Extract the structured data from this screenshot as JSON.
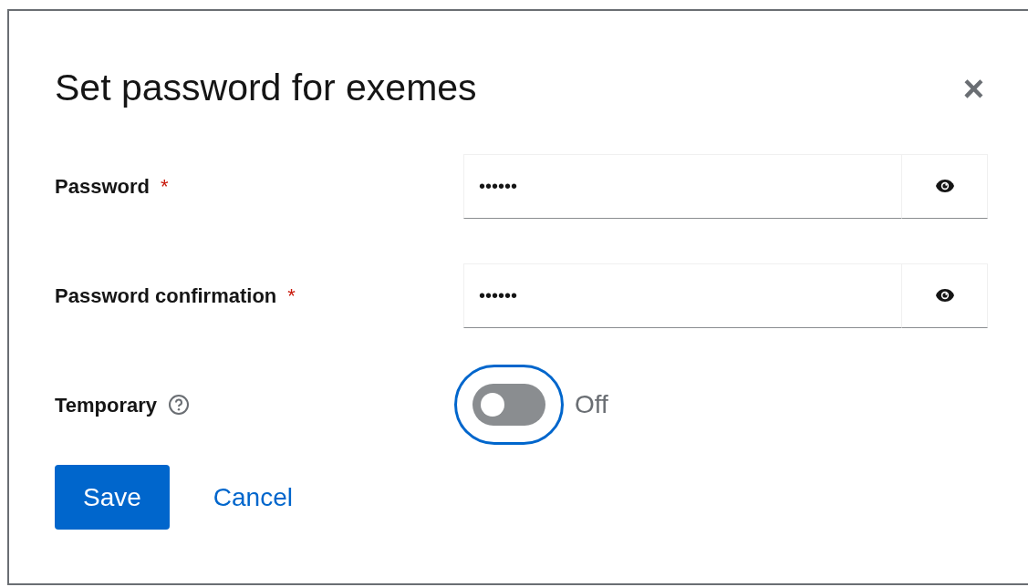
{
  "dialog": {
    "title": "Set password for exemes",
    "close": "×"
  },
  "fields": [
    {
      "kind": "password",
      "label": "Password",
      "required_mark": "*",
      "value": "••••••"
    },
    {
      "kind": "password",
      "label": "Password confirmation",
      "required_mark": "*",
      "value": "••••••"
    },
    {
      "kind": "switch",
      "label": "Temporary",
      "help": true,
      "on": false,
      "focused": true,
      "state_label": "Off"
    }
  ],
  "actions": [
    {
      "label": "Save",
      "kind": "primary"
    },
    {
      "label": "Cancel",
      "kind": "link"
    }
  ]
}
